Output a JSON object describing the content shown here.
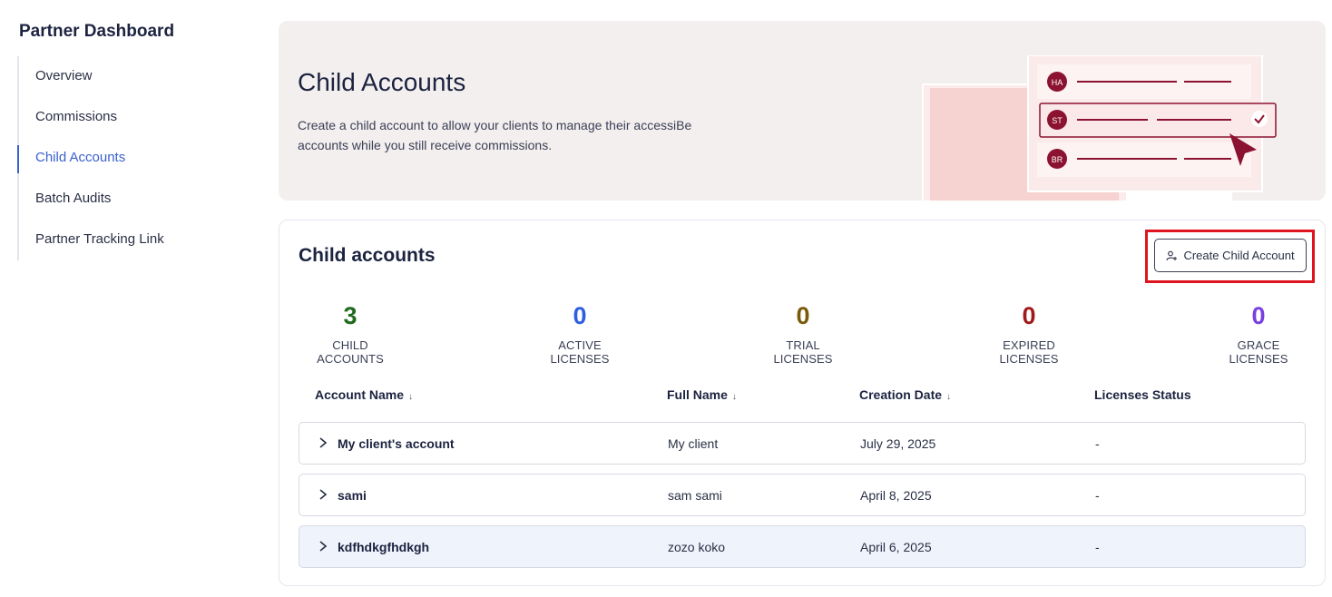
{
  "sidebar": {
    "title": "Partner Dashboard",
    "items": [
      {
        "label": "Overview"
      },
      {
        "label": "Commissions"
      },
      {
        "label": "Child Accounts",
        "active": true
      },
      {
        "label": "Batch Audits"
      },
      {
        "label": "Partner Tracking Link"
      }
    ]
  },
  "hero": {
    "title": "Child Accounts",
    "description": "Create a child account to allow your clients to manage their accessiBe accounts while you still receive commissions.",
    "illustration": {
      "avatars": [
        "HA",
        "ST",
        "BR"
      ],
      "accent": "#8b1230"
    }
  },
  "card": {
    "title": "Child accounts",
    "create_button": "Create Child Account",
    "create_button_icon": "add-user-icon"
  },
  "stats": [
    {
      "value": "3",
      "label": "CHILD ACCOUNTS",
      "color": "#1f6b1f"
    },
    {
      "value": "0",
      "label": "ACTIVE LICENSES",
      "color": "#2f5fe0"
    },
    {
      "value": "0",
      "label": "TRIAL LICENSES",
      "color": "#7a5a0a"
    },
    {
      "value": "0",
      "label": "EXPIRED LICENSES",
      "color": "#a01a1a"
    },
    {
      "value": "0",
      "label": "GRACE LICENSES",
      "color": "#7a3fe0"
    }
  ],
  "table": {
    "columns": [
      "Account Name",
      "Full Name",
      "Creation Date",
      "Licenses Status"
    ],
    "rows": [
      {
        "account": "My client's account",
        "full_name": "My client",
        "date": "July 29, 2025",
        "status": "-"
      },
      {
        "account": "sami",
        "full_name": "sam sami",
        "date": "April 8, 2025",
        "status": "-"
      },
      {
        "account": "kdfhdkgfhdkgh",
        "full_name": "zozo koko",
        "date": "April 6, 2025",
        "status": "-"
      }
    ]
  }
}
